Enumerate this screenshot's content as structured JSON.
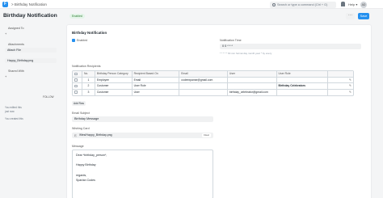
{
  "topbar": {
    "logo": "F",
    "breadcrumb": "> Birthday Notification",
    "search_placeholder": "Search or type a command (Ctrl + G)",
    "help": "Help ▾",
    "avatar": "AD"
  },
  "header": {
    "title": "Birthday Notification",
    "status": "Enabled",
    "menu": "···",
    "save": "Save"
  },
  "sidebar": {
    "assigned_to": "Assigned To",
    "attachments": "Attachments",
    "attach_file": "Attach File",
    "attachment_item": "Happy_Birthday.png",
    "shared_with": "Shared With",
    "follow": "FOLLOW",
    "activity": [
      "You edited this",
      "just now",
      "You created this"
    ]
  },
  "form": {
    "section_title": "Birthday Notification",
    "enabled_label": "Enabled",
    "notification_time_label": "Notification Time",
    "notification_time_value": "0 0 * * *",
    "notification_time_hint": "* * * * * hh:mm format day month year * by every",
    "recipients_label": "Notification Recipients",
    "recipients_columns": [
      "",
      "No.",
      "Birthday Person Category",
      "Recipient Based On",
      "Email",
      "User",
      "User Role",
      ""
    ],
    "recipients_rows": [
      {
        "no": "1",
        "category": "Employee",
        "based_on": "Email",
        "email": "codeexpanse@gmail.com",
        "user": "",
        "role": ""
      },
      {
        "no": "2",
        "category": "Customer",
        "based_on": "User Role",
        "email": "",
        "user": "",
        "role": "Birthday Celebrators"
      },
      {
        "no": "3",
        "category": "Customer",
        "based_on": "User",
        "email": "",
        "user": "birthday_celebrator@gmail.com",
        "role": ""
      }
    ],
    "add_row": "Add Row",
    "email_subject_label": "Email Subject",
    "email_subject_value": "Birthday Message",
    "wishing_card_label": "Wishing Card",
    "wishing_card_file": "/files/Happy_Birthday.png",
    "clear": "Clear",
    "message_label": "Message",
    "message_lines": [
      "Dear *birthday_person*,",
      "Happy Birthday",
      "regards,",
      "Spartan Codes"
    ]
  }
}
